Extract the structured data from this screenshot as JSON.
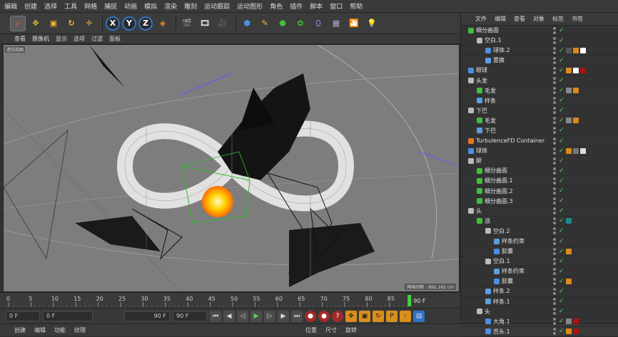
{
  "menubar": [
    "编辑",
    "创建",
    "选择",
    "工具",
    "网格",
    "捕捉",
    "动画",
    "模拟",
    "渲染",
    "雕刻",
    "运动跟踪",
    "运动图形",
    "角色",
    "插件",
    "脚本",
    "窗口",
    "帮助"
  ],
  "viewport_menu": [
    "查看",
    "摄像机",
    "显示",
    "选项",
    "过滤",
    "面板"
  ],
  "viewport": {
    "label": "透视视图",
    "info": "网格间距 : 892.162 cm"
  },
  "timeline": {
    "ticks": [
      "0",
      "5",
      "10",
      "15",
      "20",
      "25",
      "30",
      "35",
      "40",
      "45",
      "50",
      "55",
      "60",
      "65",
      "70",
      "75",
      "80",
      "85"
    ],
    "end_label": "90 F",
    "current": "90 F"
  },
  "transport": {
    "start": "0 F",
    "min": "0 F",
    "max": "90 F",
    "end": "90 F"
  },
  "bottom_left": [
    "创建",
    "编辑",
    "功能",
    "纹理"
  ],
  "bottom_right": [
    "位置",
    "尺寸",
    "旋转"
  ],
  "panel_menu": [
    "文件",
    "编辑",
    "查看",
    "对象",
    "标签",
    "书签"
  ],
  "objects": [
    {
      "name": "细分曲面",
      "indent": 0,
      "icon": "#3fbf3f",
      "tags": []
    },
    {
      "name": "空白.1",
      "indent": 1,
      "icon": "#bbbbbb",
      "tags": []
    },
    {
      "name": "球体.2",
      "indent": 2,
      "icon": "#4a90e2",
      "tags": [
        "#555",
        "#d88a1a",
        "#ffffff"
      ]
    },
    {
      "name": "置换",
      "indent": 2,
      "icon": "#5aa0e0",
      "tags": []
    },
    {
      "name": "眼球",
      "indent": 0,
      "icon": "#4a90e2",
      "tags": [
        "#d88a1a",
        "#ffffff",
        "#b01010"
      ]
    },
    {
      "name": "头发",
      "indent": 0,
      "icon": "#bbbbbb",
      "tags": []
    },
    {
      "name": "毛发",
      "indent": 1,
      "icon": "#3fbf3f",
      "tags": [
        "#888",
        "#d88a1a"
      ]
    },
    {
      "name": "样条",
      "indent": 1,
      "icon": "#5aa0e0",
      "tags": []
    },
    {
      "name": "下巴",
      "indent": 0,
      "icon": "#bbbbbb",
      "tags": []
    },
    {
      "name": "毛发",
      "indent": 1,
      "icon": "#3fbf3f",
      "tags": [
        "#888",
        "#d88a1a"
      ]
    },
    {
      "name": "下巴",
      "indent": 1,
      "icon": "#5aa0e0",
      "tags": []
    },
    {
      "name": "TurbulenceFD Container",
      "indent": 0,
      "icon": "#e07a20",
      "tags": []
    },
    {
      "name": "球体",
      "indent": 0,
      "icon": "#4a90e2",
      "tags": [
        "#d88a1a",
        "#777",
        "#ddd"
      ]
    },
    {
      "name": "腿",
      "indent": 0,
      "icon": "#bbbbbb",
      "tags": []
    },
    {
      "name": "细分曲面",
      "indent": 1,
      "icon": "#3fbf3f",
      "tags": []
    },
    {
      "name": "细分曲面.1",
      "indent": 1,
      "icon": "#3fbf3f",
      "tags": []
    },
    {
      "name": "细分曲面.2",
      "indent": 1,
      "icon": "#3fbf3f",
      "tags": []
    },
    {
      "name": "细分曲面.3",
      "indent": 1,
      "icon": "#3fbf3f",
      "tags": []
    },
    {
      "name": "头",
      "indent": 0,
      "icon": "#bbbbbb",
      "tags": []
    },
    {
      "name": "须",
      "indent": 1,
      "icon": "#3fbf3f",
      "tags": [
        "#1a8a8a"
      ]
    },
    {
      "name": "空白.2",
      "indent": 2,
      "icon": "#bbbbbb",
      "tags": []
    },
    {
      "name": "样条约束",
      "indent": 3,
      "icon": "#5aa0e0",
      "tags": []
    },
    {
      "name": "胶囊",
      "indent": 3,
      "icon": "#4a90e2",
      "tags": [
        "#d88a1a"
      ]
    },
    {
      "name": "空白.1",
      "indent": 2,
      "icon": "#bbbbbb",
      "tags": []
    },
    {
      "name": "样条约束",
      "indent": 3,
      "icon": "#5aa0e0",
      "tags": []
    },
    {
      "name": "胶囊",
      "indent": 3,
      "icon": "#4a90e2",
      "tags": [
        "#d88a1a"
      ]
    },
    {
      "name": "样条.2",
      "indent": 2,
      "icon": "#5aa0e0",
      "tags": []
    },
    {
      "name": "样条.1",
      "indent": 2,
      "icon": "#5aa0e0",
      "tags": []
    },
    {
      "name": "头",
      "indent": 1,
      "icon": "#bbbbbb",
      "tags": []
    },
    {
      "name": "大角.1",
      "indent": 2,
      "icon": "#4a90e2",
      "tags": [
        "#888",
        "#b01010"
      ]
    },
    {
      "name": "舌头.1",
      "indent": 2,
      "icon": "#4a90e2",
      "tags": [
        "#d88a1a",
        "#b01010"
      ]
    }
  ],
  "colors": {
    "accent": "#2e74c6",
    "check": "#5ed65e",
    "viewport_bg": "#7d7d7d"
  }
}
